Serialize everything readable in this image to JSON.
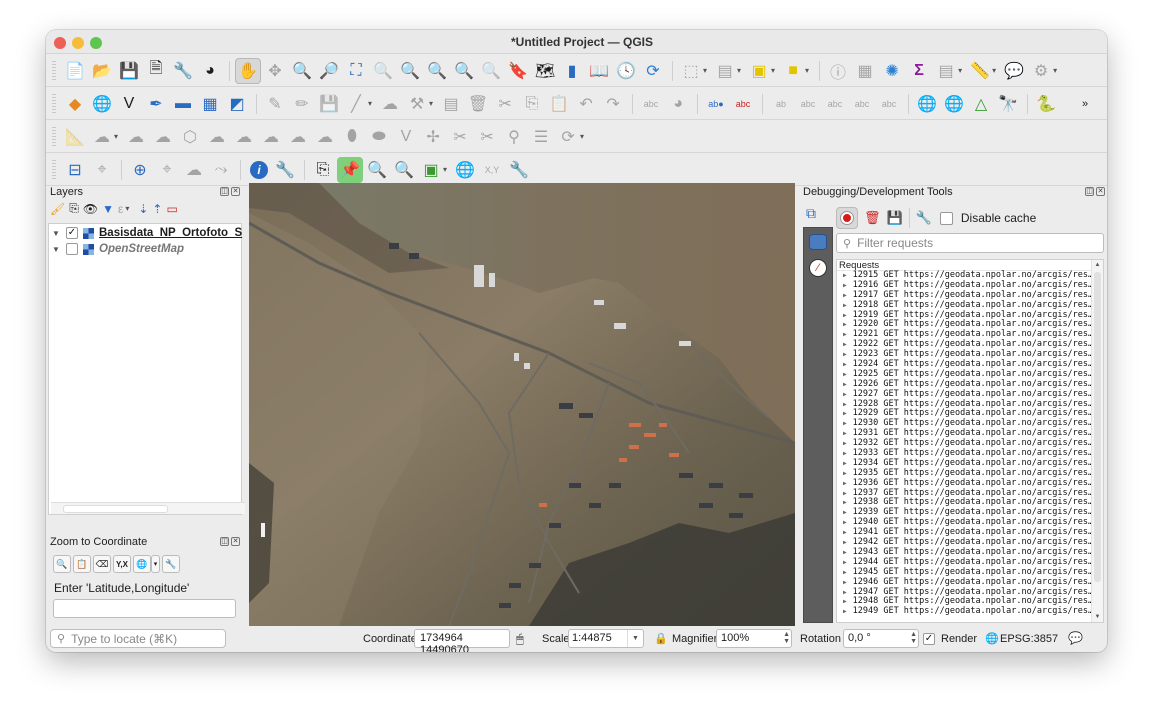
{
  "window": {
    "title": "*Untitled Project — QGIS"
  },
  "toolbars": {
    "row1": [
      "new-project",
      "open-project",
      "save-project",
      "new-print-layout",
      "layout-manager",
      "style-manager",
      "pan-map",
      "pan-to-selection",
      "zoom-in",
      "zoom-out",
      "zoom-full",
      "zoom-to-selection",
      "zoom-to-layer",
      "zoom-native",
      "zoom-last",
      "zoom-next",
      "new-spatial-bookmark",
      "show-bookmarks",
      "show-spatial-bookmark-manager",
      "new-3d-map",
      "temporal-controller",
      "refresh",
      "select-features",
      "deselect",
      "select-by-expression",
      "select-by-location",
      "identify-features",
      "open-attribute-table",
      "settings-gear",
      "statistical-summary",
      "field-calculator",
      "measure-line",
      "map-tips",
      "toggle-actions"
    ],
    "row2": [
      "data-source-manager",
      "add-wms-layer",
      "add-vector-layer",
      "digitize",
      "add-mesh",
      "add-raster",
      "add-virtual-layer",
      "current-edits",
      "toggle-editing",
      "save-edits",
      "add-line",
      "vertex-tool",
      "modify-attributes",
      "delete-selected",
      "cut-features",
      "copy-features",
      "paste-features",
      "undo",
      "redo",
      "label-toolbar",
      "diagram",
      "layer-labeling",
      "highlight-labels",
      "pin-labels",
      "show-hide-labels",
      "move-label",
      "rotate-label",
      "change-label",
      "add-server-layer",
      "add-wfs-layer",
      "add-arcgis",
      "metasearch",
      "python-console"
    ],
    "overflow_label": "»"
  },
  "layers_panel": {
    "title": "Layers",
    "items": [
      {
        "name": "Basisdata_NP_Ortofoto_S",
        "checked": true,
        "bold": true
      },
      {
        "name": "OpenStreetMap",
        "checked": false,
        "italic": true
      }
    ]
  },
  "zoom_to_coordinate": {
    "title": "Zoom to Coordinate",
    "prompt": "Enter 'Latitude,Longitude'",
    "value": "",
    "buttons": [
      "zoom",
      "paste",
      "clear",
      "Y,X",
      "crs",
      "settings"
    ]
  },
  "locator": {
    "placeholder": "Type to locate (⌘K)"
  },
  "debug_panel": {
    "title": "Debugging/Development Tools",
    "disable_cache_label": "Disable cache",
    "disable_cache_checked": false,
    "filter_placeholder": "Filter requests",
    "requests_header": "Requests",
    "requests": [
      {
        "id": "12915",
        "method": "GET",
        "url": "https://geodata.npolar.no/arcgis/res…"
      },
      {
        "id": "12916",
        "method": "GET",
        "url": "https://geodata.npolar.no/arcgis/res…"
      },
      {
        "id": "12917",
        "method": "GET",
        "url": "https://geodata.npolar.no/arcgis/res…"
      },
      {
        "id": "12918",
        "method": "GET",
        "url": "https://geodata.npolar.no/arcgis/res…"
      },
      {
        "id": "12919",
        "method": "GET",
        "url": "https://geodata.npolar.no/arcgis/res…"
      },
      {
        "id": "12920",
        "method": "GET",
        "url": "https://geodata.npolar.no/arcgis/res…"
      },
      {
        "id": "12921",
        "method": "GET",
        "url": "https://geodata.npolar.no/arcgis/res…"
      },
      {
        "id": "12922",
        "method": "GET",
        "url": "https://geodata.npolar.no/arcgis/res…"
      },
      {
        "id": "12923",
        "method": "GET",
        "url": "https://geodata.npolar.no/arcgis/res…"
      },
      {
        "id": "12924",
        "method": "GET",
        "url": "https://geodata.npolar.no/arcgis/res…"
      },
      {
        "id": "12925",
        "method": "GET",
        "url": "https://geodata.npolar.no/arcgis/res…"
      },
      {
        "id": "12926",
        "method": "GET",
        "url": "https://geodata.npolar.no/arcgis/res…"
      },
      {
        "id": "12927",
        "method": "GET",
        "url": "https://geodata.npolar.no/arcgis/res…"
      },
      {
        "id": "12928",
        "method": "GET",
        "url": "https://geodata.npolar.no/arcgis/res…"
      },
      {
        "id": "12929",
        "method": "GET",
        "url": "https://geodata.npolar.no/arcgis/res…"
      },
      {
        "id": "12930",
        "method": "GET",
        "url": "https://geodata.npolar.no/arcgis/res…"
      },
      {
        "id": "12931",
        "method": "GET",
        "url": "https://geodata.npolar.no/arcgis/res…"
      },
      {
        "id": "12932",
        "method": "GET",
        "url": "https://geodata.npolar.no/arcgis/res…"
      },
      {
        "id": "12933",
        "method": "GET",
        "url": "https://geodata.npolar.no/arcgis/res…"
      },
      {
        "id": "12934",
        "method": "GET",
        "url": "https://geodata.npolar.no/arcgis/res…"
      },
      {
        "id": "12935",
        "method": "GET",
        "url": "https://geodata.npolar.no/arcgis/res…"
      },
      {
        "id": "12936",
        "method": "GET",
        "url": "https://geodata.npolar.no/arcgis/res…"
      },
      {
        "id": "12937",
        "method": "GET",
        "url": "https://geodata.npolar.no/arcgis/res…"
      },
      {
        "id": "12938",
        "method": "GET",
        "url": "https://geodata.npolar.no/arcgis/res…"
      },
      {
        "id": "12939",
        "method": "GET",
        "url": "https://geodata.npolar.no/arcgis/res…"
      },
      {
        "id": "12940",
        "method": "GET",
        "url": "https://geodata.npolar.no/arcgis/res…"
      },
      {
        "id": "12941",
        "method": "GET",
        "url": "https://geodata.npolar.no/arcgis/res…"
      },
      {
        "id": "12942",
        "method": "GET",
        "url": "https://geodata.npolar.no/arcgis/res…"
      },
      {
        "id": "12943",
        "method": "GET",
        "url": "https://geodata.npolar.no/arcgis/res…"
      },
      {
        "id": "12944",
        "method": "GET",
        "url": "https://geodata.npolar.no/arcgis/res…"
      },
      {
        "id": "12945",
        "method": "GET",
        "url": "https://geodata.npolar.no/arcgis/res…"
      },
      {
        "id": "12946",
        "method": "GET",
        "url": "https://geodata.npolar.no/arcgis/res…"
      },
      {
        "id": "12947",
        "method": "GET",
        "url": "https://geodata.npolar.no/arcgis/res…"
      },
      {
        "id": "12948",
        "method": "GET",
        "url": "https://geodata.npolar.no/arcgis/res…"
      },
      {
        "id": "12949",
        "method": "GET",
        "url": "https://geodata.npolar.no/arcgis/res…"
      }
    ]
  },
  "statusbar": {
    "coordinate_label": "Coordinate",
    "coordinate_value": "1734964  14490670",
    "scale_label": "Scale",
    "scale_value": "1:44875",
    "magnifier_label": "Magnifier",
    "magnifier_value": "100%",
    "rotation_label": "Rotation",
    "rotation_value": "0,0 °",
    "render_label": "Render",
    "render_checked": true,
    "crs_label": "EPSG:3857"
  }
}
